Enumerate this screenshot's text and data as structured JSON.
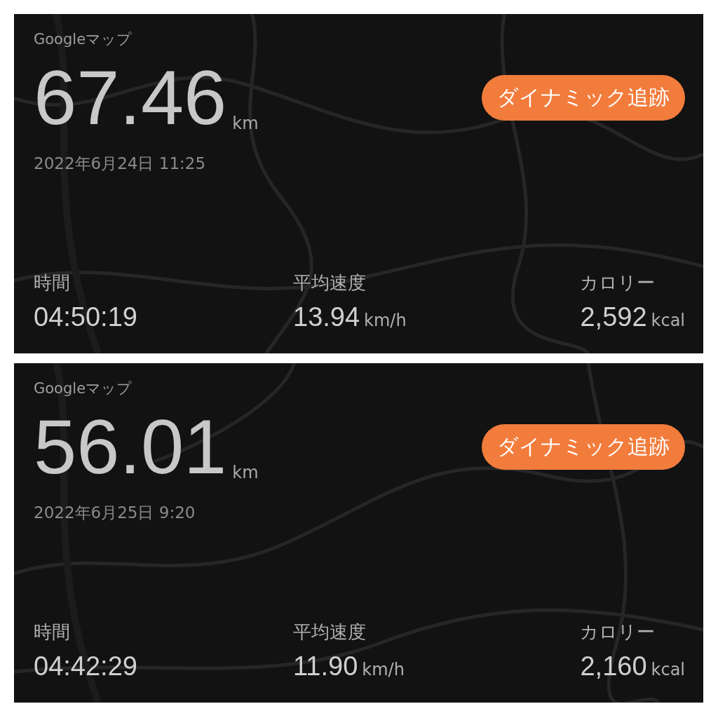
{
  "cards": [
    {
      "source": "Googleマップ",
      "distance": "67.46",
      "distance_unit": "km",
      "button": "ダイナミック追跡",
      "date": "2022年6月24日 11:25",
      "stats": [
        {
          "label": "時間",
          "value": "04:50:19"
        },
        {
          "label": "平均速度",
          "value": "13.94",
          "unit": "km/h"
        },
        {
          "label": "カロリー",
          "value": "2,592",
          "unit": "kcal"
        }
      ]
    },
    {
      "source": "Googleマップ",
      "distance": "56.01",
      "distance_unit": "km",
      "button": "ダイナミック追跡",
      "date": "2022年6月25日 9:20",
      "stats": [
        {
          "label": "時間",
          "value": "04:42:29"
        },
        {
          "label": "平均速度",
          "value": "11.90",
          "unit": "km/h"
        },
        {
          "label": "カロリー",
          "value": "2,160",
          "unit": "kcal"
        }
      ]
    }
  ]
}
